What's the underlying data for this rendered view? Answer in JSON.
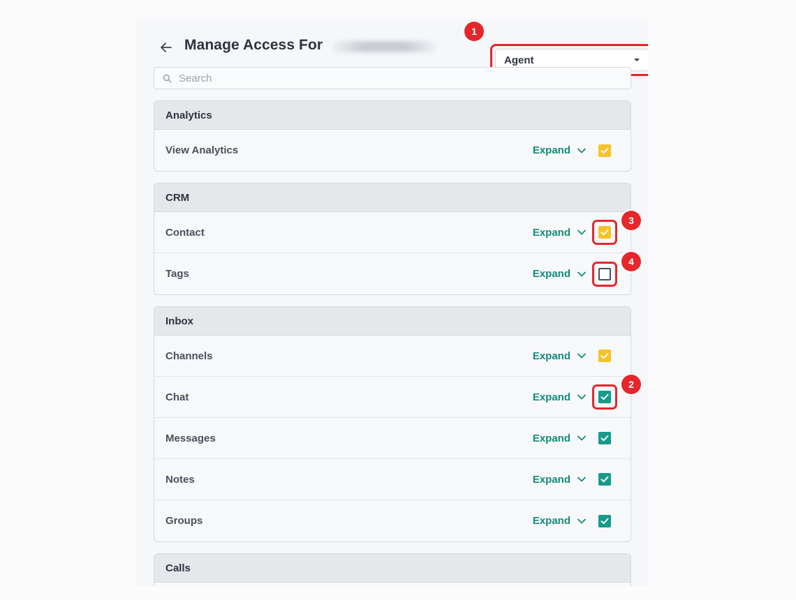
{
  "header": {
    "title": "Manage Access For",
    "role_value": "Agent"
  },
  "search": {
    "placeholder": "Search"
  },
  "sections": [
    {
      "title": "Analytics",
      "rows": [
        {
          "label": "View Analytics",
          "expand": "Expand",
          "state": "partial"
        }
      ]
    },
    {
      "title": "CRM",
      "rows": [
        {
          "label": "Contact",
          "expand": "Expand",
          "state": "partial"
        },
        {
          "label": "Tags",
          "expand": "Expand",
          "state": "unchecked"
        }
      ]
    },
    {
      "title": "Inbox",
      "rows": [
        {
          "label": "Channels",
          "expand": "Expand",
          "state": "partial"
        },
        {
          "label": "Chat",
          "expand": "Expand",
          "state": "checked"
        },
        {
          "label": "Messages",
          "expand": "Expand",
          "state": "checked"
        },
        {
          "label": "Notes",
          "expand": "Expand",
          "state": "checked"
        },
        {
          "label": "Groups",
          "expand": "Expand",
          "state": "checked"
        }
      ]
    },
    {
      "title": "Calls",
      "rows": []
    }
  ],
  "annotations": [
    "1",
    "2",
    "3",
    "4"
  ],
  "colors": {
    "accent_teal": "#138a7a",
    "checkbox_green": "#169a8a",
    "checkbox_yellow": "#f6c326",
    "annotation_red": "#e5262b"
  }
}
